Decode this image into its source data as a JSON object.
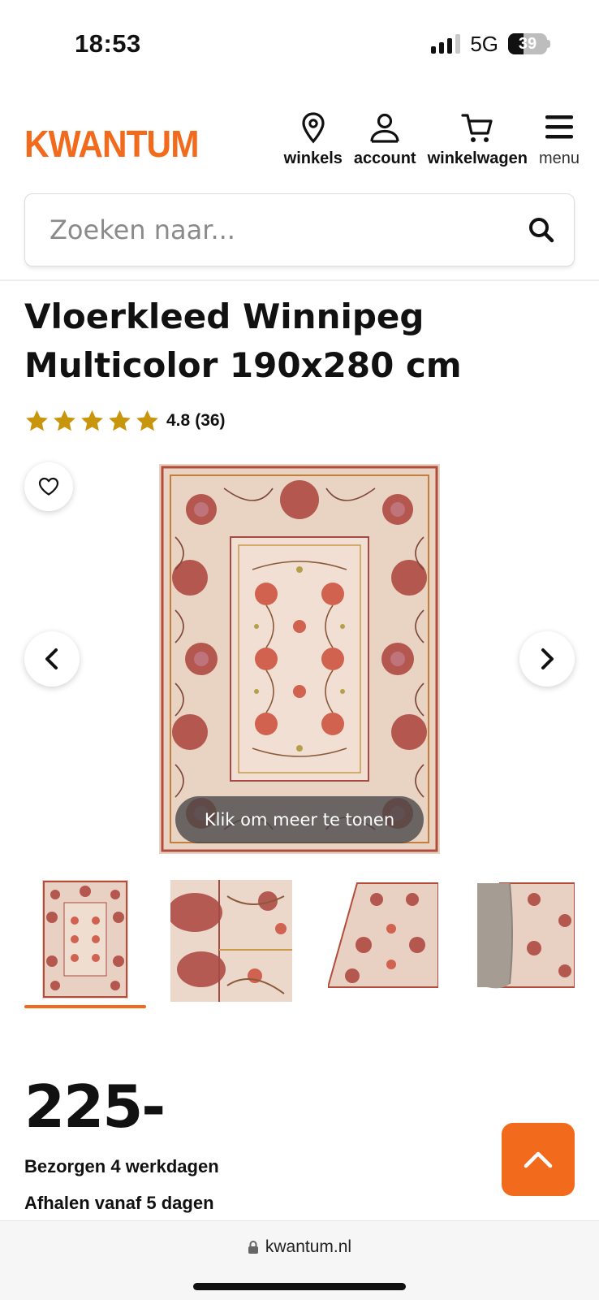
{
  "status_bar": {
    "time": "18:53",
    "network": "5G",
    "battery_level": "39",
    "battery_fraction": 0.39
  },
  "header": {
    "logo": "KWANTUM",
    "brand_color": "#f26b1d",
    "nav": [
      {
        "label": "winkels",
        "icon": "location-pin-icon"
      },
      {
        "label": "account",
        "icon": "user-icon"
      },
      {
        "label": "winkelwagen",
        "icon": "cart-icon"
      },
      {
        "label": "menu",
        "icon": "hamburger-menu-icon"
      }
    ]
  },
  "search": {
    "placeholder": "Zoeken naar...",
    "icon": "search-icon"
  },
  "product": {
    "title": "Vloerkleed Winnipeg Multicolor 190x280 cm",
    "rating_value": "4.8",
    "rating_count": "(36)",
    "stars": 5,
    "star_color": "#c8960c"
  },
  "gallery": {
    "overlay_text": "Klik om meer te tonen",
    "thumbnail_count": 4,
    "active_thumbnail": 0
  },
  "pricing": {
    "price": "225-",
    "delivery": "Bezorgen 4 werkdagen",
    "pickup": "Afhalen vanaf 5 dagen"
  },
  "browser": {
    "url": "kwantum.nl"
  }
}
